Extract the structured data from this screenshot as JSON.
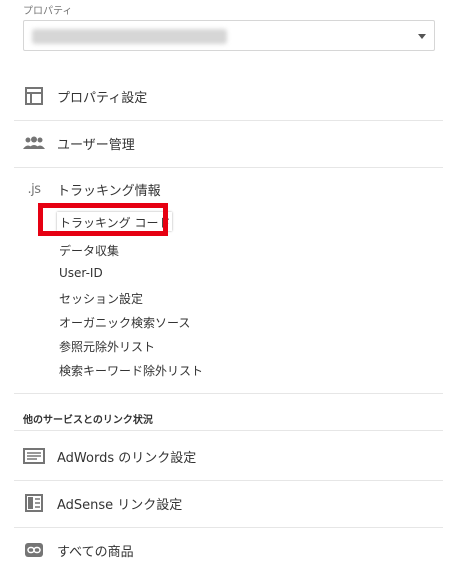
{
  "property": {
    "label": "プロパティ",
    "selected_value": ""
  },
  "menu": {
    "property_settings": "プロパティ設定",
    "user_management": "ユーザー管理",
    "tracking_info": "トラッキング情報",
    "tracking_icon_text": ".js"
  },
  "tracking_submenu": [
    "トラッキング コード",
    "データ収集",
    "User-ID",
    "セッション設定",
    "オーガニック検索ソース",
    "参照元除外リスト",
    "検索キーワード除外リスト"
  ],
  "links_section": {
    "title": "他のサービスとのリンク状況",
    "adwords": "AdWords のリンク設定",
    "adsense": "AdSense リンク設定",
    "all_products": "すべての商品"
  },
  "colors": {
    "highlight": "#e60012",
    "icon": "#757575",
    "divider": "#e6e6e6"
  }
}
